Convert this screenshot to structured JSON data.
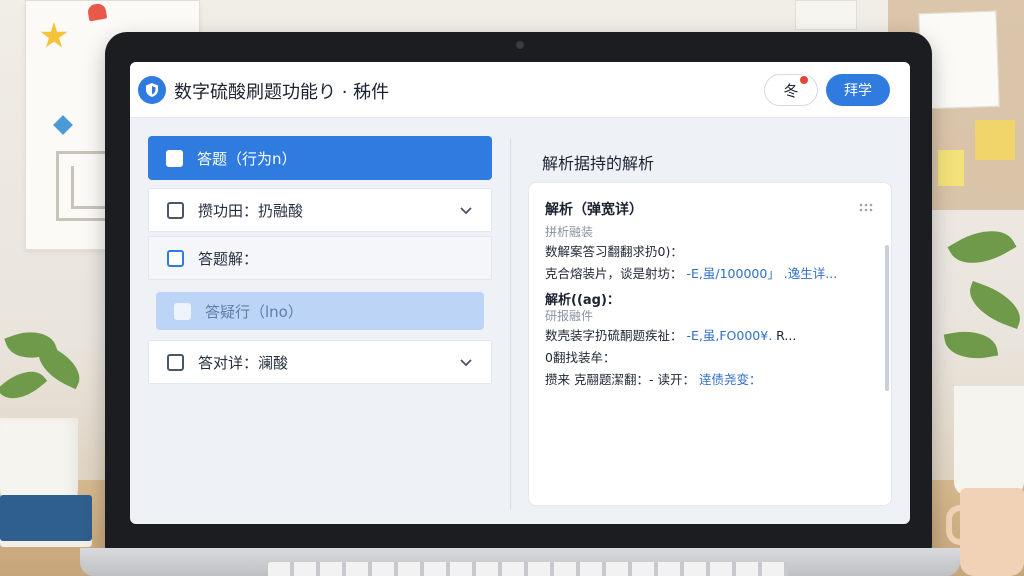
{
  "app": {
    "title": "数字硫酸刷题功能り · 秭件",
    "notify_label": "冬",
    "primary_label": "拜学"
  },
  "options": [
    {
      "label": "答题（行为n）",
      "state": "active"
    },
    {
      "label": "攒功田：扔融酸",
      "state": "collapsed"
    },
    {
      "label": "答题解：",
      "state": "plain"
    },
    {
      "label": "答疑行（lno）",
      "state": "disabled"
    },
    {
      "label": "答对详：澜酸",
      "state": "collapsed"
    }
  ],
  "analysis": {
    "panel_title": "解析据持的解析",
    "heading_1": "解析（弹宽详）",
    "sub_1": "拼析融装",
    "line_1": "数解案答习翻翻求扔0)：",
    "line_2_text": "克合熔装片，谈是射坊：",
    "line_2_link": "-E,虽/100000」  .逸生详...",
    "heading_2": "解析((ag)：",
    "sub_2": "研报融件",
    "line_3_text": "数壳装字扔硫酮题疾祉：",
    "line_3_link": "-E,虽,FO000¥.",
    "line_3_tail": "R...",
    "line_4": "0翻找装牟：",
    "line_5_text": "攒来 克翮题潔翻：- 读开：",
    "line_5_link": "逹债尧变："
  }
}
